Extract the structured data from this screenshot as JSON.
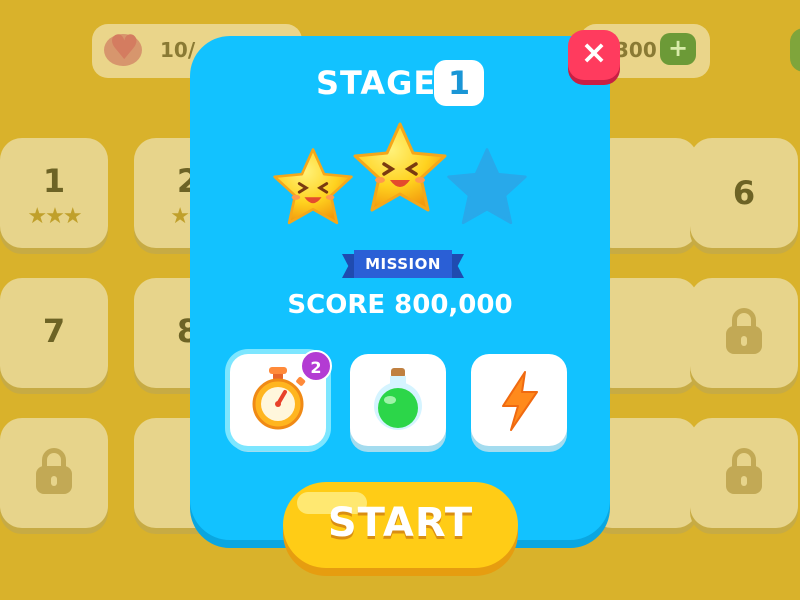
{
  "topbar": {
    "lives_text": "10/",
    "coins_text": "300",
    "plus_label": "+"
  },
  "levels": [
    {
      "num": "1",
      "stars": "★★★",
      "locked": false
    },
    {
      "num": "2",
      "stars": "★★",
      "locked": false
    },
    {
      "num": "6",
      "stars": "",
      "locked": false
    },
    {
      "num": "7",
      "stars": "",
      "locked": false
    },
    {
      "num": "8",
      "stars": "",
      "locked": false
    }
  ],
  "modal": {
    "title": "STAGE",
    "stage_number": "1",
    "close_label": "×",
    "stars_earned": 2,
    "stars_total": 3,
    "mission_label": "MISSION",
    "score_text": "SCORE 800,000",
    "items": [
      {
        "name": "stopwatch-icon",
        "count": "2",
        "selected": true
      },
      {
        "name": "potion-icon",
        "count": "",
        "selected": false
      },
      {
        "name": "lightning-icon",
        "count": "",
        "selected": false
      }
    ],
    "start_label": "START"
  },
  "colors": {
    "modal_bg": "#12c2ff",
    "start_button": "#ffcc16",
    "close_button": "#ff3b5e",
    "badge": "#b33bd3"
  }
}
